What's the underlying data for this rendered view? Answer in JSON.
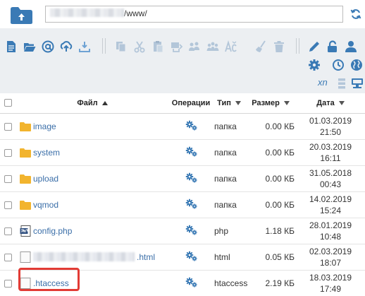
{
  "path": {
    "prefix_hidden": true,
    "visible_suffix": "/www/"
  },
  "toolbar": {
    "buttons": [
      "new-file-icon",
      "open-folder-icon",
      "at-icon",
      "upload-icon",
      "download-icon",
      "copy-icon",
      "cut-icon",
      "paste-icon",
      "duplicate-icon",
      "users-icon",
      "rename-icon",
      "clear-icon",
      "delete-icon",
      "edit-icon",
      "unlock-icon",
      "user-icon",
      "settings-icon",
      "history-icon",
      "globe-icon"
    ],
    "xn_label": "xn"
  },
  "table": {
    "headers": {
      "file": "Файл",
      "ops": "Операции",
      "type": "Тип",
      "size": "Размер",
      "date": "Дата"
    },
    "rows": [
      {
        "name": "image",
        "kind": "folder",
        "type": "папка",
        "size": "0.00 КБ",
        "date": "01.03.2019",
        "time": "21:50"
      },
      {
        "name": "system",
        "kind": "folder",
        "type": "папка",
        "size": "0.00 КБ",
        "date": "20.03.2019",
        "time": "16:11"
      },
      {
        "name": "upload",
        "kind": "folder",
        "type": "папка",
        "size": "0.00 КБ",
        "date": "31.05.2018",
        "time": "00:43"
      },
      {
        "name": "vqmod",
        "kind": "folder",
        "type": "папка",
        "size": "0.00 КБ",
        "date": "14.02.2019",
        "time": "15:24"
      },
      {
        "name": "config.php",
        "kind": "php",
        "type": "php",
        "size": "1.18 КБ",
        "date": "28.01.2019",
        "time": "10:48"
      },
      {
        "name": ".html",
        "kind": "html",
        "type": "html",
        "size": "0.05 КБ",
        "date": "02.03.2019",
        "time": "18:07"
      },
      {
        "name": ".htaccess",
        "kind": "file",
        "type": "htaccess",
        "size": "2.19 КБ",
        "date": "18.03.2019",
        "time": "17:49"
      }
    ]
  },
  "colors": {
    "accent": "#3a7ab5",
    "folder": "#f2b42e",
    "highlight": "#e23b35",
    "toolbar_bg": "#eceff2"
  }
}
